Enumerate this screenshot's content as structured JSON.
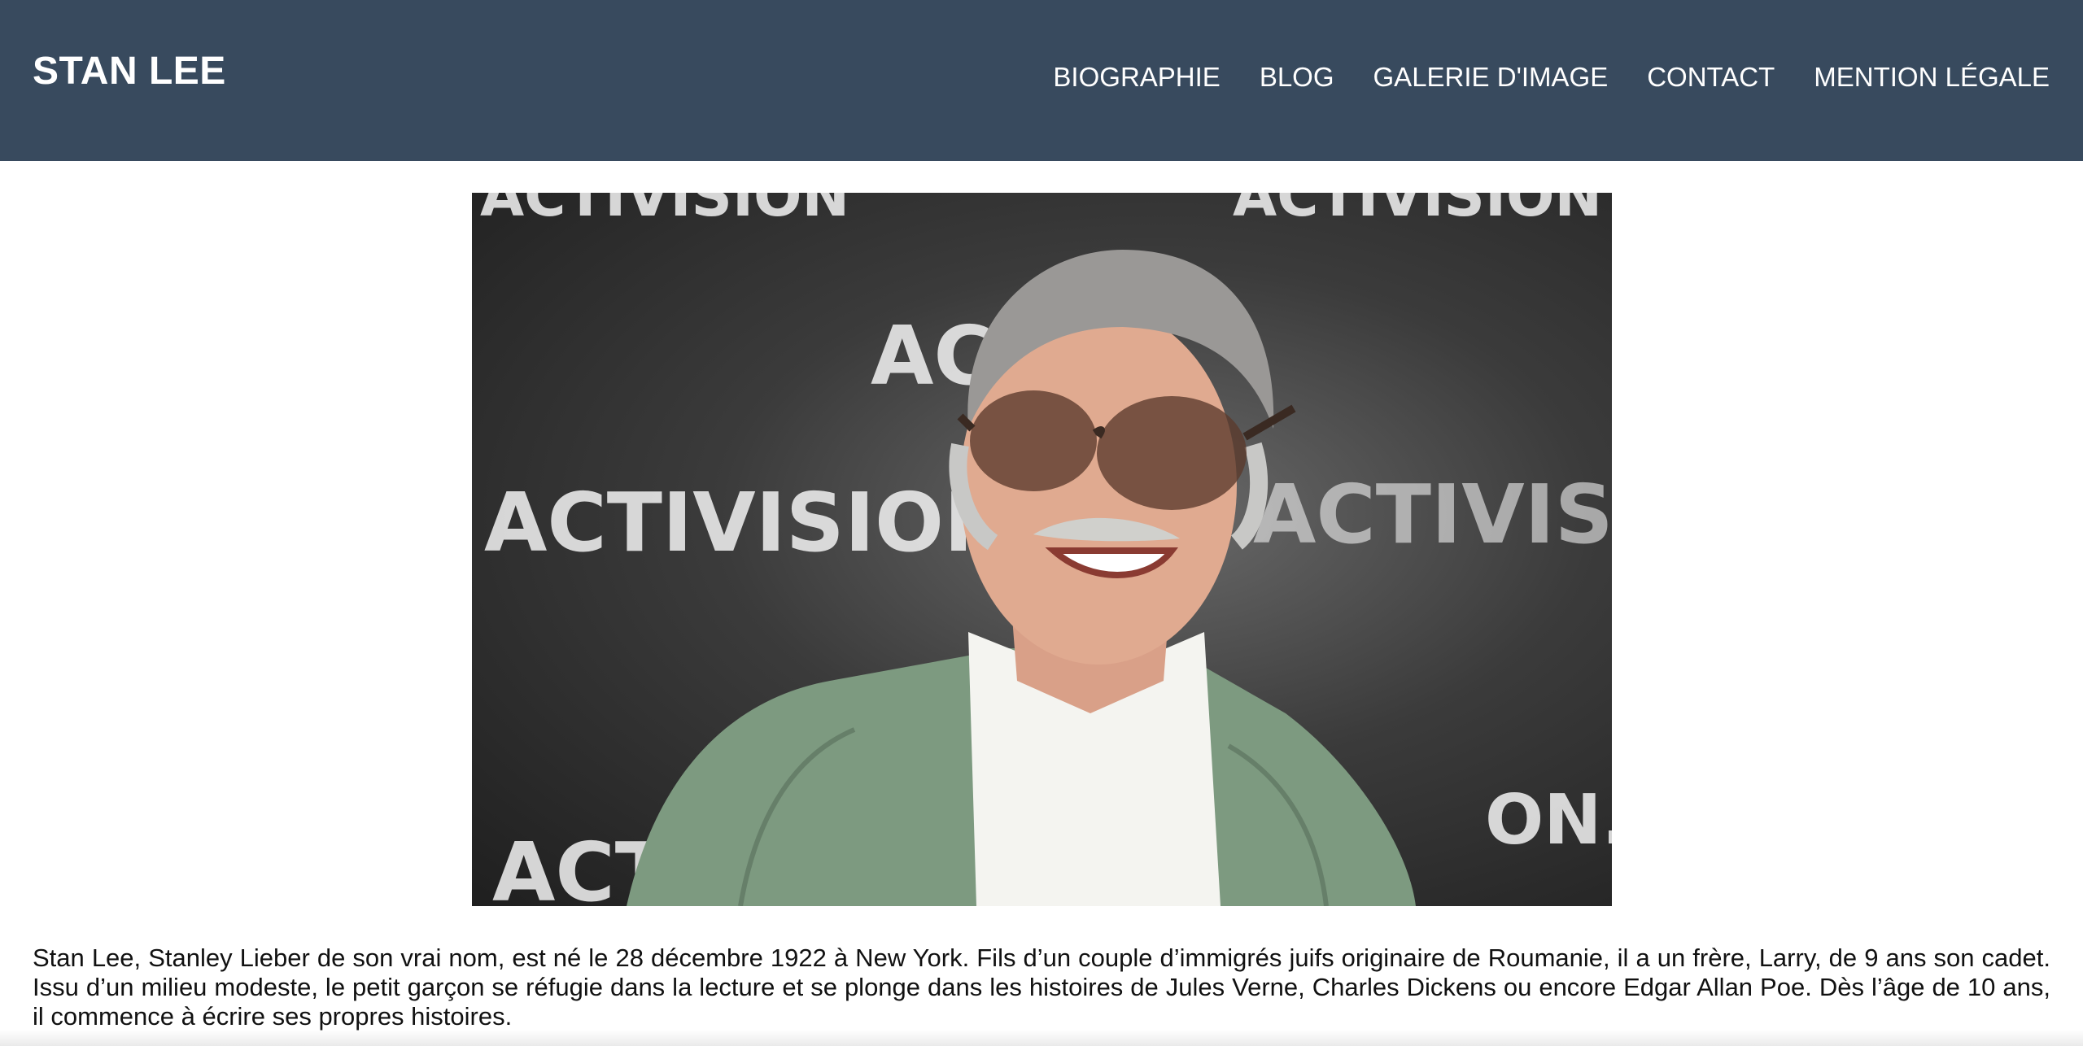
{
  "header": {
    "brand": "STAN LEE",
    "background_color": "#384a5e",
    "nav": [
      {
        "label": "BIOGRAPHIE"
      },
      {
        "label": "BLOG"
      },
      {
        "label": "GALERIE D'IMAGE"
      },
      {
        "label": "CONTACT"
      },
      {
        "label": "MENTION LÉGALE"
      }
    ]
  },
  "hero": {
    "backdrop_words": [
      "ACTIVISION",
      "ACTIVISION",
      "ACTI",
      "ACTIVISION",
      "ACTIVISION",
      "ACTI",
      "ON."
    ],
    "subject_icon": "portrait-photo"
  },
  "content": {
    "bio_text": "Stan Lee, Stanley Lieber de son vrai nom, est né le 28 décembre 1922 à New York. Fils d’un couple d’immigrés juifs originaire de Roumanie, il a un frère, Larry, de 9 ans son cadet. Issu d’un milieu modeste, le petit garçon se réfugie dans la lecture et se plonge dans les histoires de Jules Verne, Charles Dickens ou encore Edgar Allan Poe. Dès l’âge de 10 ans, il commence à écrire ses propres histoires."
  }
}
